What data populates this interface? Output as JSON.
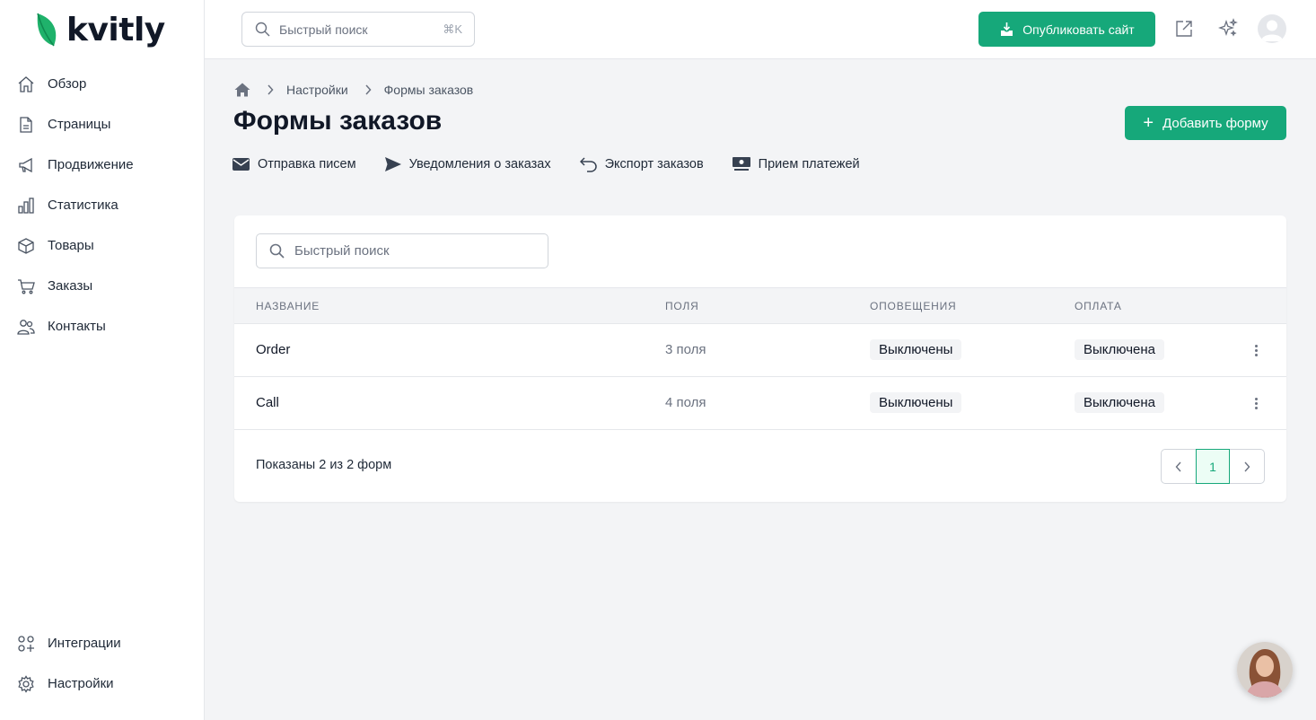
{
  "brand": {
    "name": "kvitly",
    "accent": "#16a87a",
    "leaf_color": "#1fb26b"
  },
  "sidebar": {
    "items": [
      {
        "label": "Обзор",
        "icon": "home-icon"
      },
      {
        "label": "Страницы",
        "icon": "file-icon"
      },
      {
        "label": "Продвижение",
        "icon": "megaphone-icon"
      },
      {
        "label": "Статистика",
        "icon": "bar-chart-icon"
      },
      {
        "label": "Товары",
        "icon": "box-icon"
      },
      {
        "label": "Заказы",
        "icon": "cart-icon"
      },
      {
        "label": "Контакты",
        "icon": "users-icon"
      }
    ],
    "bottom_items": [
      {
        "label": "Интеграции",
        "icon": "apps-plus-icon"
      },
      {
        "label": "Настройки",
        "icon": "gear-icon"
      }
    ]
  },
  "topbar": {
    "search_placeholder": "Быстрый поиск",
    "search_shortcut": "⌘K",
    "publish_label": "Опубликовать сайт"
  },
  "breadcrumb": {
    "items": [
      "Настройки",
      "Формы заказов"
    ]
  },
  "page": {
    "title": "Формы заказов",
    "add_button": "Добавить форму",
    "subnav": [
      {
        "label": "Отправка писем",
        "icon": "envelope-icon"
      },
      {
        "label": "Уведомления о заказах",
        "icon": "send-icon"
      },
      {
        "label": "Экспорт заказов",
        "icon": "undo-arrow-icon"
      },
      {
        "label": "Прием платежей",
        "icon": "money-icon"
      }
    ]
  },
  "table": {
    "search_placeholder": "Быстрый поиск",
    "columns": [
      "НАЗВАНИЕ",
      "ПОЛЯ",
      "ОПОВЕЩЕНИЯ",
      "ОПЛАТА"
    ],
    "rows": [
      {
        "name": "Order",
        "fields": "3 поля",
        "notifications": "Выключены",
        "payment": "Выключена"
      },
      {
        "name": "Call",
        "fields": "4 поля",
        "notifications": "Выключены",
        "payment": "Выключена"
      }
    ],
    "footer": "Показаны 2 из 2 форм",
    "current_page": "1"
  }
}
